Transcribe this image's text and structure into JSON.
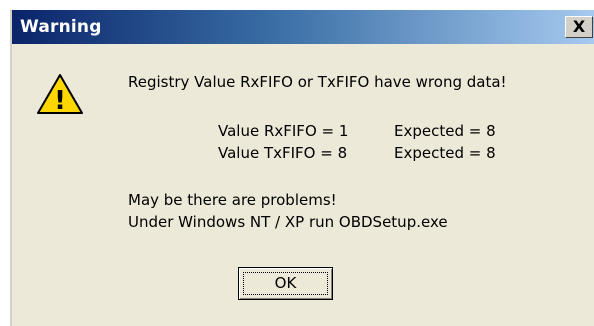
{
  "window": {
    "title": "Warning",
    "close_glyph": "X"
  },
  "icon": {
    "type": "warning-icon",
    "glyph": "!",
    "fill": "#ffd700",
    "stroke": "#000000"
  },
  "message": {
    "line1": "Registry Value RxFIFO or TxFIFO have wrong data!",
    "rx": {
      "label": "Value RxFIFO = 1",
      "expected": "Expected = 8"
    },
    "tx": {
      "label": "Value TxFIFO = 8",
      "expected": "Expected = 8"
    },
    "line4": "May be there are problems!",
    "line5": "Under Windows NT / XP run OBDSetup.exe"
  },
  "buttons": {
    "ok": "OK"
  },
  "colors": {
    "title_start": "#0a246a",
    "title_end": "#a6caf0",
    "dialog_bg": "#ece9d8"
  }
}
